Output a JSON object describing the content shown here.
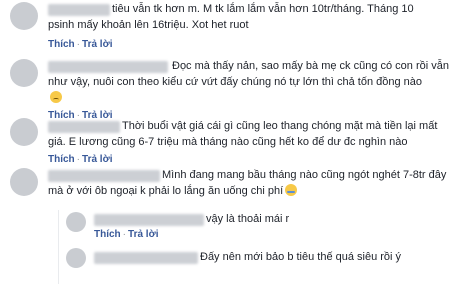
{
  "comments": [
    {
      "lines": [
        "tiêu vẫn tk hơn m. M tk lắm lắm vẫn hơn 10tr/tháng. Tháng 10",
        "psinh mấy khoản lên 16triệu. Xot het ruot"
      ],
      "like": "Thích",
      "reply": "Trả lời"
    },
    {
      "lines": [
        "Đọc mà thấy nản, sao mấy bà mẹ ck cũng có con rồi vẫn",
        "như vậy, nuôi con theo kiểu cứ vứt đấy chúng nó tự lớn thì chả tốn đồng nào"
      ],
      "emoji": "sad-emoji",
      "like": "Thích",
      "reply": "Trả lời"
    },
    {
      "lines": [
        "Thời buổi vật giá cái gì cũng leo thang chóng mặt mà tiền lại mất",
        "giá. E lương cũng 6-7 triệu mà tháng nào cũng hết ko để dư đc nghìn nào"
      ],
      "like": "Thích",
      "reply": "Trả lời"
    },
    {
      "lines": [
        "Mình đang mang bầu tháng nào cũng ngót nghét 7-8tr đây",
        "mà ở với ôb ngoại k phải lo lắng ăn uống chi phí"
      ],
      "emoji": "crying-emoji",
      "like": "Thích",
      "reply": "Trả lời"
    }
  ],
  "replies": [
    {
      "text": "vậy là thoải mái r",
      "like": "Thích",
      "reply": "Trả lời"
    },
    {
      "text": "Đấy nên mới bảo b tiêu thế quá siêu rồi ý"
    }
  ]
}
